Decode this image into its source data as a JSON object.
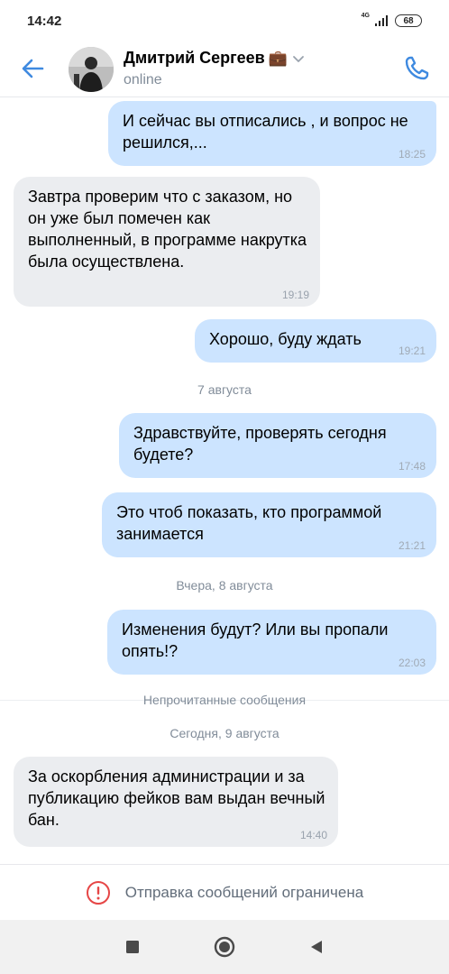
{
  "status_bar": {
    "time": "14:42",
    "network": "4G",
    "battery": "68"
  },
  "header": {
    "name": "Дмитрий Сергеев",
    "name_emoji": "💼",
    "status": "online"
  },
  "messages": [
    {
      "direction": "out",
      "text": "И сейчас вы отписались , и вопрос не решился,...",
      "time": "18:25"
    },
    {
      "direction": "in",
      "text": "Завтра проверим что с заказом, но он уже был помечен как выполненный, в программе накрутка была осуществлена.",
      "time": "19:19"
    },
    {
      "direction": "out",
      "text": "Хорошо, буду ждать",
      "time": "19:21"
    },
    {
      "direction": "out",
      "text": "Здравствуйте, проверять сегодня будете?",
      "time": "17:48"
    },
    {
      "direction": "out",
      "text": "Это чтоб показать, кто программой занимается",
      "time": "21:21"
    },
    {
      "direction": "out",
      "text": "Изменения будут? Или вы пропали опять!?",
      "time": "22:03"
    },
    {
      "direction": "in",
      "text": "За оскорбления администрации и за публикацию фейков вам выдан вечный бан.",
      "time": "14:40"
    }
  ],
  "separators": {
    "date_1": "7 августа",
    "date_2": "Вчера, 8 августа",
    "unread": "Непрочитанные сообщения",
    "date_3": "Сегодня, 9 августа"
  },
  "footer": {
    "text": "Отправка сообщений ограничена"
  },
  "colors": {
    "accent": "#3f8ae0",
    "outgoing_bubble": "#cce4ff",
    "incoming_bubble": "#ebedf0",
    "warning": "#e64646"
  },
  "icons": {
    "back": "arrow-left-icon",
    "call": "phone-icon",
    "chevron": "chevron-down-icon",
    "restricted": "exclamation-circle-icon",
    "nav_recents": "square-icon",
    "nav_home": "circle-icon",
    "nav_back": "triangle-icon"
  }
}
